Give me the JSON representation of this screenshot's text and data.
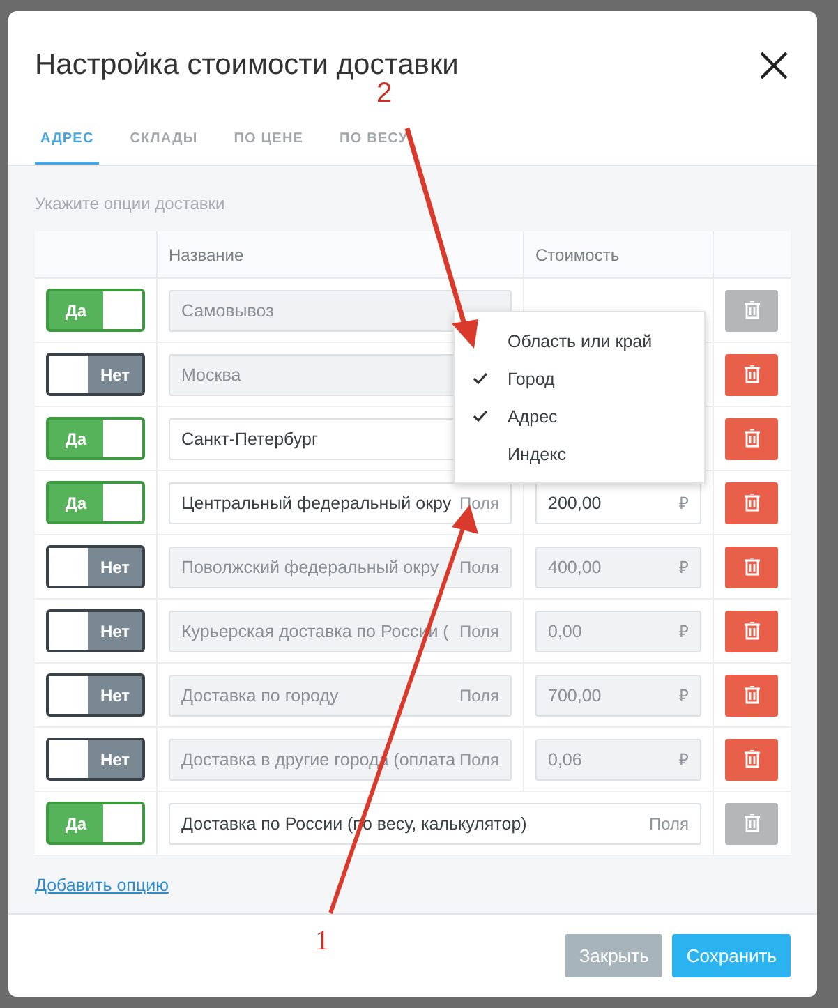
{
  "dialog": {
    "title": "Настройка стоимости доставки"
  },
  "tabs": [
    {
      "label": "АДРЕС",
      "selected": true
    },
    {
      "label": "СКЛАДЫ",
      "selected": false
    },
    {
      "label": "ПО ЦЕНЕ",
      "selected": false
    },
    {
      "label": "ПО ВЕСУ",
      "selected": false
    }
  ],
  "hint": "Укажите опции доставки",
  "table": {
    "columns": [
      "Название",
      "Стоимость"
    ],
    "rows": [
      {
        "kind": "normal",
        "enabled": true,
        "toggle": "Да",
        "name": "Самовывоз",
        "disabled": true,
        "deletable": false
      },
      {
        "kind": "normal",
        "enabled": false,
        "toggle": "Нет",
        "name": "Москва",
        "disabled": true,
        "deletable": true
      },
      {
        "kind": "normal",
        "enabled": true,
        "toggle": "Да",
        "name": "Санкт-Петербург",
        "disabled": false,
        "deletable": true
      },
      {
        "kind": "normal",
        "enabled": true,
        "toggle": "Да",
        "name": "Центральный федеральный окру",
        "fields": "Поля",
        "disabled": false,
        "cost": "200,00",
        "currency": "₽",
        "deletable": true
      },
      {
        "kind": "normal",
        "enabled": false,
        "toggle": "Нет",
        "name": "Поволжский федеральный окру",
        "fields": "Поля",
        "disabled": true,
        "cost": "400,00",
        "currency": "₽",
        "deletable": true
      },
      {
        "kind": "normal",
        "enabled": false,
        "toggle": "Нет",
        "name": "Курьерская доставка по России (",
        "fields": "Поля",
        "disabled": true,
        "cost": "0,00",
        "currency": "₽",
        "deletable": true
      },
      {
        "kind": "normal",
        "enabled": false,
        "toggle": "Нет",
        "name": "Доставка по городу",
        "fields": "Поля",
        "disabled": true,
        "cost": "700,00",
        "currency": "₽",
        "deletable": true
      },
      {
        "kind": "normal",
        "enabled": false,
        "toggle": "Нет",
        "name": "Доставка в другие города (оплата",
        "fields": "Поля",
        "disabled": true,
        "cost": "0,06",
        "currency": "₽",
        "deletable": true
      },
      {
        "kind": "wide",
        "enabled": true,
        "toggle": "Да",
        "name": "Доставка по России (по весу, калькулятор)",
        "wide_fields": "Поля",
        "disabled": false,
        "deletable": false
      }
    ]
  },
  "dropdown": {
    "items": [
      {
        "label": "Область или край",
        "checked": false
      },
      {
        "label": "Город",
        "checked": true
      },
      {
        "label": "Адрес",
        "checked": true
      },
      {
        "label": "Индекс",
        "checked": false
      }
    ]
  },
  "add_link": "Добавить опцию",
  "buttons": [
    {
      "label": "Закрыть",
      "kind": "secondary"
    },
    {
      "label": "Сохранить",
      "kind": "primary"
    }
  ],
  "annotations": [
    {
      "label": "2"
    },
    {
      "label": "1"
    }
  ]
}
